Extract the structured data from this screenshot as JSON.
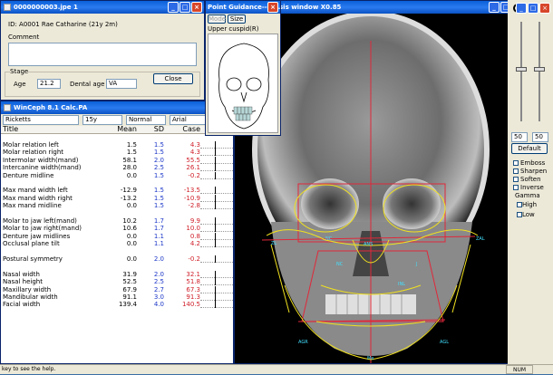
{
  "image_window": {
    "title": "0000000003.jpe 1",
    "id_line": "ID: A0001  Rae Catharine (21y 2m)",
    "comment_label": "Comment",
    "stage_label": "Stage",
    "age_label": "Age",
    "age_value": "21.2",
    "dental_age_label": "Dental age",
    "dental_age_value": "VA",
    "close_button": "Close"
  },
  "point_guidance": {
    "title": "Point Guidance--Fu...",
    "mode_button": "Mode",
    "size_button": "Size",
    "point_label": "Upper cuspid(R)"
  },
  "xray_window": {
    "title": "aw analysis window X0.85"
  },
  "calc_window": {
    "title": "WinCeph 8.1 Calc.PA",
    "analysis_select": "Ricketts",
    "age_select": "15y",
    "norm_select": "Normal",
    "font_select": "Arial",
    "headers": {
      "title": "Title",
      "mean": "Mean",
      "sd": "SD",
      "case": "Case"
    },
    "rows": [
      {
        "title": "",
        "mean": "",
        "sd": "",
        "case": ""
      },
      {
        "title": "Molar relation left",
        "mean": "1.5",
        "sd": "1.5",
        "case": "4.3"
      },
      {
        "title": "Molar relation right",
        "mean": "1.5",
        "sd": "1.5",
        "case": "4.3"
      },
      {
        "title": "Intermolar width(mand)",
        "mean": "58.1",
        "sd": "2.0",
        "case": "55.5"
      },
      {
        "title": "Intercanine width(mand)",
        "mean": "28.0",
        "sd": "2.5",
        "case": "26.1"
      },
      {
        "title": "Denture midline",
        "mean": "0.0",
        "sd": "1.5",
        "case": "-0.2"
      },
      {
        "title": "",
        "mean": "",
        "sd": "",
        "case": ""
      },
      {
        "title": "Max mand width left",
        "mean": "-12.9",
        "sd": "1.5",
        "case": "-13.5"
      },
      {
        "title": "Max mand width right",
        "mean": "-13.2",
        "sd": "1.5",
        "case": "-10.9"
      },
      {
        "title": "Max mand midline",
        "mean": "0.0",
        "sd": "1.5",
        "case": "-2.8"
      },
      {
        "title": "",
        "mean": "",
        "sd": "",
        "case": ""
      },
      {
        "title": "Molar to jaw left(mand)",
        "mean": "10.2",
        "sd": "1.7",
        "case": "9.9"
      },
      {
        "title": "Molar to jaw right(mand)",
        "mean": "10.6",
        "sd": "1.7",
        "case": "10.0"
      },
      {
        "title": "Denture jaw midlines",
        "mean": "0.0",
        "sd": "1.1",
        "case": "0.8"
      },
      {
        "title": "Occlusal plane tilt",
        "mean": "0.0",
        "sd": "1.1",
        "case": "4.2"
      },
      {
        "title": "",
        "mean": "",
        "sd": "",
        "case": ""
      },
      {
        "title": "Postural symmetry",
        "mean": "0.0",
        "sd": "2.0",
        "case": "-0.2"
      },
      {
        "title": "",
        "mean": "",
        "sd": "",
        "case": ""
      },
      {
        "title": "Nasal width",
        "mean": "31.9",
        "sd": "2.0",
        "case": "32.1"
      },
      {
        "title": "Nasal height",
        "mean": "52.5",
        "sd": "2.5",
        "case": "51.8"
      },
      {
        "title": "Maxillary width",
        "mean": "67.9",
        "sd": "2.7",
        "case": "67.3"
      },
      {
        "title": "Mandibular width",
        "mean": "91.1",
        "sd": "3.0",
        "case": "91.3"
      },
      {
        "title": "Facial width",
        "mean": "139.4",
        "sd": "4.0",
        "case": "140.5"
      }
    ]
  },
  "right_panel": {
    "spin_left": "50",
    "spin_right": "50",
    "default_button": "Default",
    "options": [
      "Emboss",
      "Sharpen",
      "Soften",
      "Inverse"
    ],
    "gamma_label": "Gamma",
    "gamma_options": [
      "High",
      "Low"
    ]
  },
  "statusbar": {
    "text": "key to see the help.",
    "num": "NUM"
  }
}
